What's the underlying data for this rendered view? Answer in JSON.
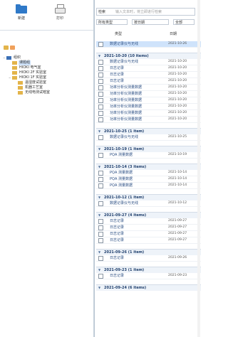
{
  "toolbar": {
    "new_label": "新建",
    "print_label": "打印"
  },
  "tree": {
    "items": [
      {
        "label": "组织",
        "level": 0,
        "icon": "org-icon",
        "expander": "−"
      },
      {
        "label": "课题组",
        "level": 1,
        "icon": "folder-icon",
        "expander": "",
        "selected": true
      },
      {
        "label": "HIOKI 电气室",
        "level": 1,
        "icon": "folder-icon",
        "expander": ""
      },
      {
        "label": "HIOKI 2F 实验室",
        "level": 1,
        "icon": "folder-icon",
        "expander": ""
      },
      {
        "label": "HIOKI 1F 实验室",
        "level": 1,
        "icon": "folder-icon",
        "expander": "−"
      },
      {
        "label": "温湿度试验室",
        "level": 2,
        "icon": "folder-icon",
        "expander": ""
      },
      {
        "label": "机器工艺室",
        "level": 2,
        "icon": "folder-icon",
        "expander": ""
      },
      {
        "label": "无线电测试暗室",
        "level": 2,
        "icon": "folder-icon",
        "expander": ""
      }
    ]
  },
  "search": {
    "label": "检索",
    "placeholder": "输入文本时，将立即进行检索"
  },
  "filter": {
    "category": "所有类型",
    "sort": "按日期",
    "all": "全部"
  },
  "columns": {
    "type": "类型",
    "date": "日期"
  },
  "first_row": {
    "name": "数据记录仪与无线",
    "date": "2021-10-26"
  },
  "groups": [
    {
      "title": "2021-10-20 (10 items)",
      "rows": [
        {
          "name": "数据记录仪与无线",
          "date": "2021-10-20"
        },
        {
          "name": "日志记录",
          "date": "2021-10-20"
        },
        {
          "name": "日志记录",
          "date": "2021-10-20"
        },
        {
          "name": "日志记录",
          "date": "2021-10-20"
        },
        {
          "name": "功率分析仪测量数据",
          "date": "2021-10-20"
        },
        {
          "name": "功率分析仪测量数据",
          "date": "2021-10-20"
        },
        {
          "name": "功率分析仪测量数据",
          "date": "2021-10-20"
        },
        {
          "name": "功率分析仪测量数据",
          "date": "2021-10-20"
        },
        {
          "name": "功率分析仪测量数据",
          "date": "2021-10-20"
        },
        {
          "name": "功率分析仪测量数据",
          "date": "2021-10-20"
        }
      ]
    },
    {
      "title": "2021-10-25 (1 item)",
      "rows": [
        {
          "name": "数据记录仪与无线",
          "date": "2021-10-25"
        }
      ]
    },
    {
      "title": "2021-10-19 (1 item)",
      "rows": [
        {
          "name": "PQA 测量数据",
          "date": "2021-10-19"
        }
      ]
    },
    {
      "title": "2021-10-14 (3 items)",
      "rows": [
        {
          "name": "PQA 测量数据",
          "date": "2021-10-14"
        },
        {
          "name": "PQA 测量数据",
          "date": "2021-10-14"
        },
        {
          "name": "PQA 测量数据",
          "date": "2021-10-14"
        }
      ]
    },
    {
      "title": "2021-10-12 (1 item)",
      "rows": [
        {
          "name": "数据记录仪与无线",
          "date": "2021-10-12"
        }
      ]
    },
    {
      "title": "2021-09-27 (4 items)",
      "rows": [
        {
          "name": "日志记录",
          "date": "2021-09-27"
        },
        {
          "name": "日志记录",
          "date": "2021-09-27"
        },
        {
          "name": "日志记录",
          "date": "2021-09-27"
        },
        {
          "name": "日志记录",
          "date": "2021-09-27"
        }
      ]
    },
    {
      "title": "2021-09-26 (1 item)",
      "rows": [
        {
          "name": "日志记录",
          "date": "2021-09-26"
        }
      ]
    },
    {
      "title": "2021-09-23 (1 item)",
      "rows": [
        {
          "name": "日志记录",
          "date": "2021-09-23"
        }
      ]
    },
    {
      "title": "2021-09-24 (6 items)",
      "rows": []
    }
  ],
  "colors": {
    "accent": "#2f79c8",
    "selection": "#cfe3fb",
    "folder": "#e3b44a",
    "org": "#3b6fb6"
  }
}
